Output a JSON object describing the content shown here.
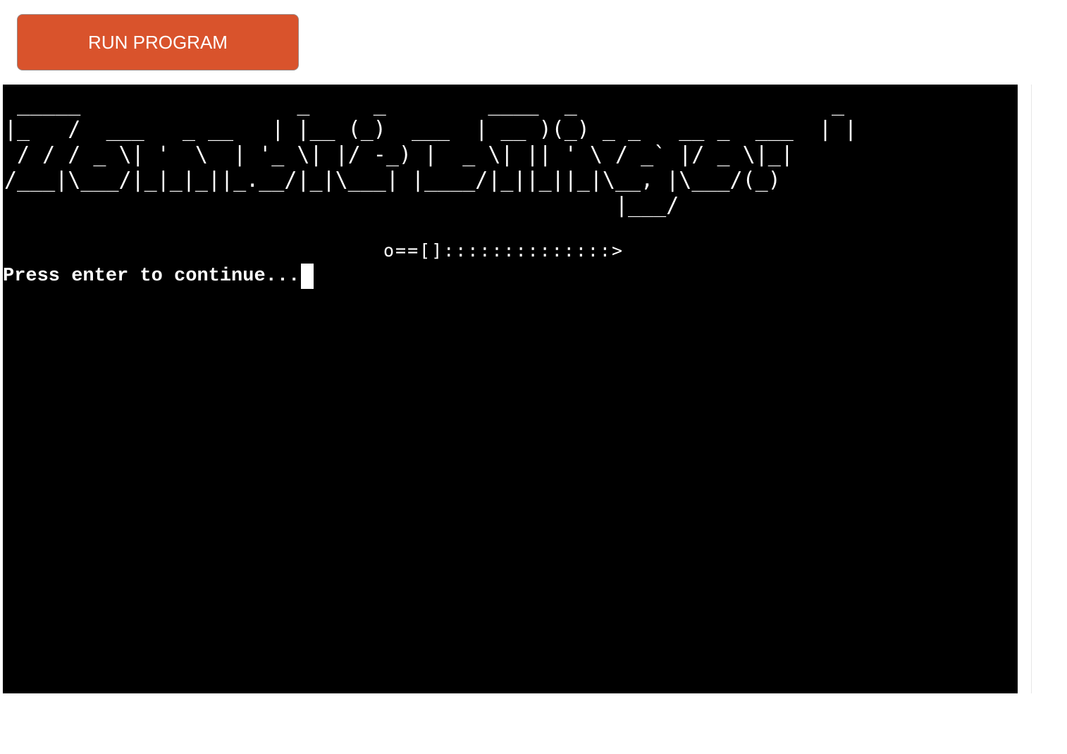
{
  "toolbar": {
    "run_label": "RUN PROGRAM"
  },
  "terminal": {
    "banner": " _____                 _     _        ____  _                    _ \n|_   /  ___   _ __   | |__ (_)  ___  | __ )(_) _ _   __ _  ___  | |\n / / / _ \\| '  \\  | '_ \\| |/ -_) |  _ \\| || ' \\ / _` |/ _ \\|_|\n/___|\\___/|_|_|_||_.__/|_|\\___| |____/|_||_||_|\\__, |\\___/(_)\n                                                |___/",
    "sword": "o==[]::::::::::::::>",
    "prompt": "Press enter to continue..."
  },
  "colors": {
    "button_bg": "#d9532c",
    "terminal_bg": "#000000",
    "terminal_fg": "#ffffff"
  }
}
